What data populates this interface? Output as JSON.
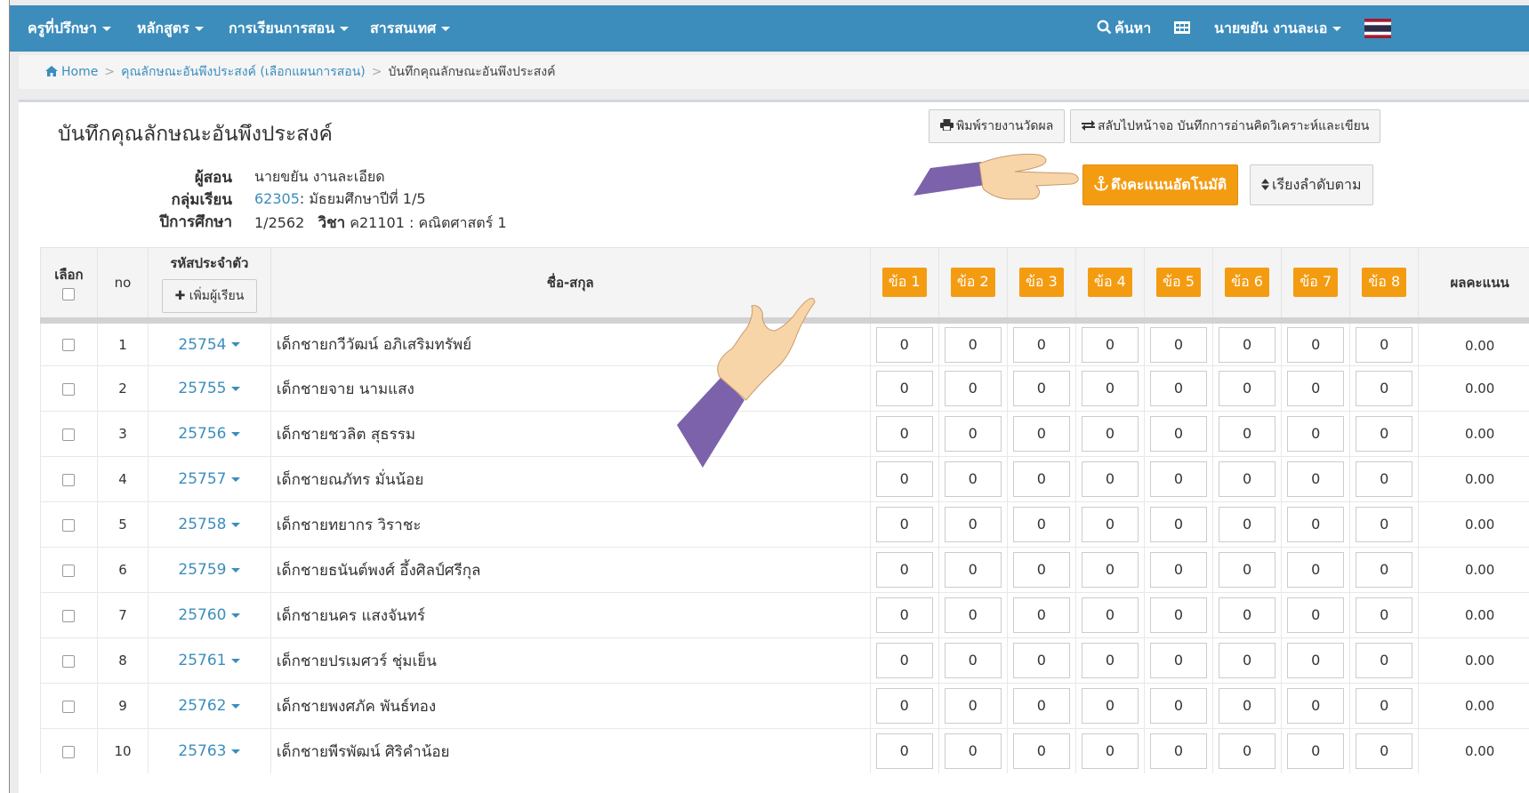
{
  "navbar": {
    "items": [
      {
        "label": "ครูที่ปรึกษา"
      },
      {
        "label": "หลักสูตร"
      },
      {
        "label": "การเรียนการสอน"
      },
      {
        "label": "สารสนเทศ"
      }
    ],
    "search_label": "ค้นหา",
    "user_name": "นายขยัน งานละเอ",
    "colors": {
      "bar": "#3c8dbc"
    }
  },
  "breadcrumb": {
    "home": "Home",
    "parent": "คุณลักษณะอันพึงประสงค์ (เลือกแผนการสอน)",
    "current": "บันทึกคุณลักษณะอันพึงประสงค์"
  },
  "page": {
    "title": "บันทึกคุณลักษณะอันพึงประสงค์",
    "print_button": "พิมพ์รายงานวัดผล",
    "switch_button": "สลับไปหน้าจอ บันทึกการอ่านคิดวิเคราะห์และเขียน",
    "auto_score_button": "ดึงคะแนนอัตโนมัติ",
    "sort_button": "เรียงลำดับตาม"
  },
  "info": {
    "teacher_label": "ผู้สอน",
    "teacher_value": "นายขยัน งานละเอียด",
    "group_label": "กลุ่มเรียน",
    "group_code": "62305",
    "group_desc": ": มัธยมศึกษาปีที่ 1/5",
    "year_label": "ปีการศึกษา",
    "year_value": "1/2562",
    "subject_label": "วิชา",
    "subject_value": "ค21101 : คณิตศาสตร์ 1"
  },
  "table": {
    "headers": {
      "select": "เลือก",
      "no": "no",
      "student_id": "รหัสประจำตัว",
      "add_student": "เพิ่มผู้เรียน",
      "name": "ชื่อ-สกุล",
      "items": [
        "ข้อ 1",
        "ข้อ 2",
        "ข้อ 3",
        "ข้อ 4",
        "ข้อ 5",
        "ข้อ 6",
        "ข้อ 7",
        "ข้อ 8"
      ],
      "result": "ผลคะแนน"
    },
    "rows": [
      {
        "no": "1",
        "id": "25754",
        "name": "เด็กชายกวีวัฒน์ อภิเสริมทรัพย์",
        "scores": [
          "0",
          "0",
          "0",
          "0",
          "0",
          "0",
          "0",
          "0"
        ],
        "result": "0.00"
      },
      {
        "no": "2",
        "id": "25755",
        "name": "เด็กชายจาย นามแสง",
        "scores": [
          "0",
          "0",
          "0",
          "0",
          "0",
          "0",
          "0",
          "0"
        ],
        "result": "0.00"
      },
      {
        "no": "3",
        "id": "25756",
        "name": "เด็กชายชวลิต สุธรรม",
        "scores": [
          "0",
          "0",
          "0",
          "0",
          "0",
          "0",
          "0",
          "0"
        ],
        "result": "0.00"
      },
      {
        "no": "4",
        "id": "25757",
        "name": "เด็กชายณภัทร มั่นน้อย",
        "scores": [
          "0",
          "0",
          "0",
          "0",
          "0",
          "0",
          "0",
          "0"
        ],
        "result": "0.00"
      },
      {
        "no": "5",
        "id": "25758",
        "name": "เด็กชายทยากร วิราชะ",
        "scores": [
          "0",
          "0",
          "0",
          "0",
          "0",
          "0",
          "0",
          "0"
        ],
        "result": "0.00"
      },
      {
        "no": "6",
        "id": "25759",
        "name": "เด็กชายธนันต์พงศ์ อึ้งศิลป์ศรีกุล",
        "scores": [
          "0",
          "0",
          "0",
          "0",
          "0",
          "0",
          "0",
          "0"
        ],
        "result": "0.00"
      },
      {
        "no": "7",
        "id": "25760",
        "name": "เด็กชายนคร แสงจันทร์",
        "scores": [
          "0",
          "0",
          "0",
          "0",
          "0",
          "0",
          "0",
          "0"
        ],
        "result": "0.00"
      },
      {
        "no": "8",
        "id": "25761",
        "name": "เด็กชายปรเมศวร์ ชุ่มเย็น",
        "scores": [
          "0",
          "0",
          "0",
          "0",
          "0",
          "0",
          "0",
          "0"
        ],
        "result": "0.00"
      },
      {
        "no": "9",
        "id": "25762",
        "name": "เด็กชายพงศภัค พันธ์ทอง",
        "scores": [
          "0",
          "0",
          "0",
          "0",
          "0",
          "0",
          "0",
          "0"
        ],
        "result": "0.00"
      },
      {
        "no": "10",
        "id": "25763",
        "name": "เด็กชายพีรพัฒน์ ศิริคำน้อย",
        "scores": [
          "0",
          "0",
          "0",
          "0",
          "0",
          "0",
          "0",
          "0"
        ],
        "result": "0.00"
      }
    ]
  },
  "colors": {
    "accent": "#f39c12",
    "link": "#3c8dbc",
    "pointer_sleeve": "#7b62ab",
    "pointer_hand": "#f8d5a8"
  }
}
